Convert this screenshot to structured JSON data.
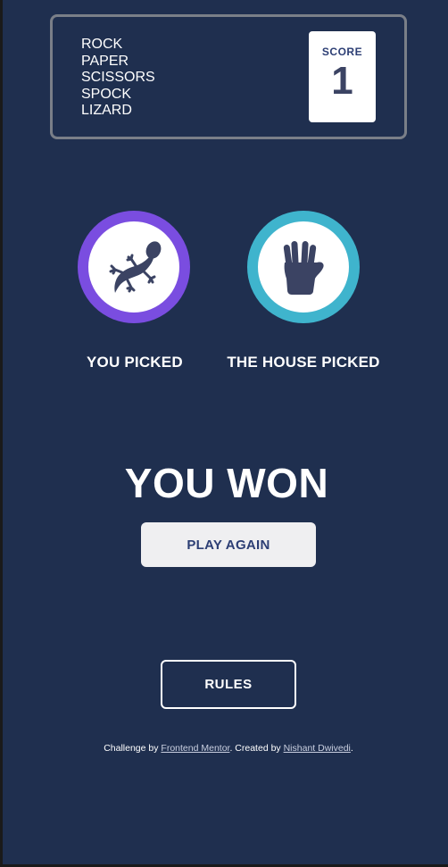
{
  "header": {
    "title_lines": [
      "ROCK",
      "PAPER",
      "SCISSORS",
      "SPOCK",
      "LIZARD"
    ],
    "score_label": "SCORE",
    "score_value": "1"
  },
  "picks": {
    "you": {
      "choice": "lizard",
      "icon": "lizard-icon",
      "ring_color": "#7a4de0",
      "label": "YOU PICKED"
    },
    "house": {
      "choice": "spock",
      "icon": "spock-hand-icon",
      "ring_color": "#3fb4cd",
      "label": "THE HOUSE PICKED"
    }
  },
  "result": {
    "text": "YOU WON",
    "play_again_label": "PLAY AGAIN"
  },
  "rules": {
    "label": "RULES"
  },
  "attribution": {
    "prefix": "Challenge by ",
    "link1": "Frontend Mentor",
    "middle": ". Created by ",
    "link2": "Nishant Dwivedi",
    "suffix": "."
  },
  "colors": {
    "background": "#1f2f4f",
    "header_border": "#7a7f88",
    "score_text": "#3b4363",
    "icon_fill": "#3b4363"
  }
}
